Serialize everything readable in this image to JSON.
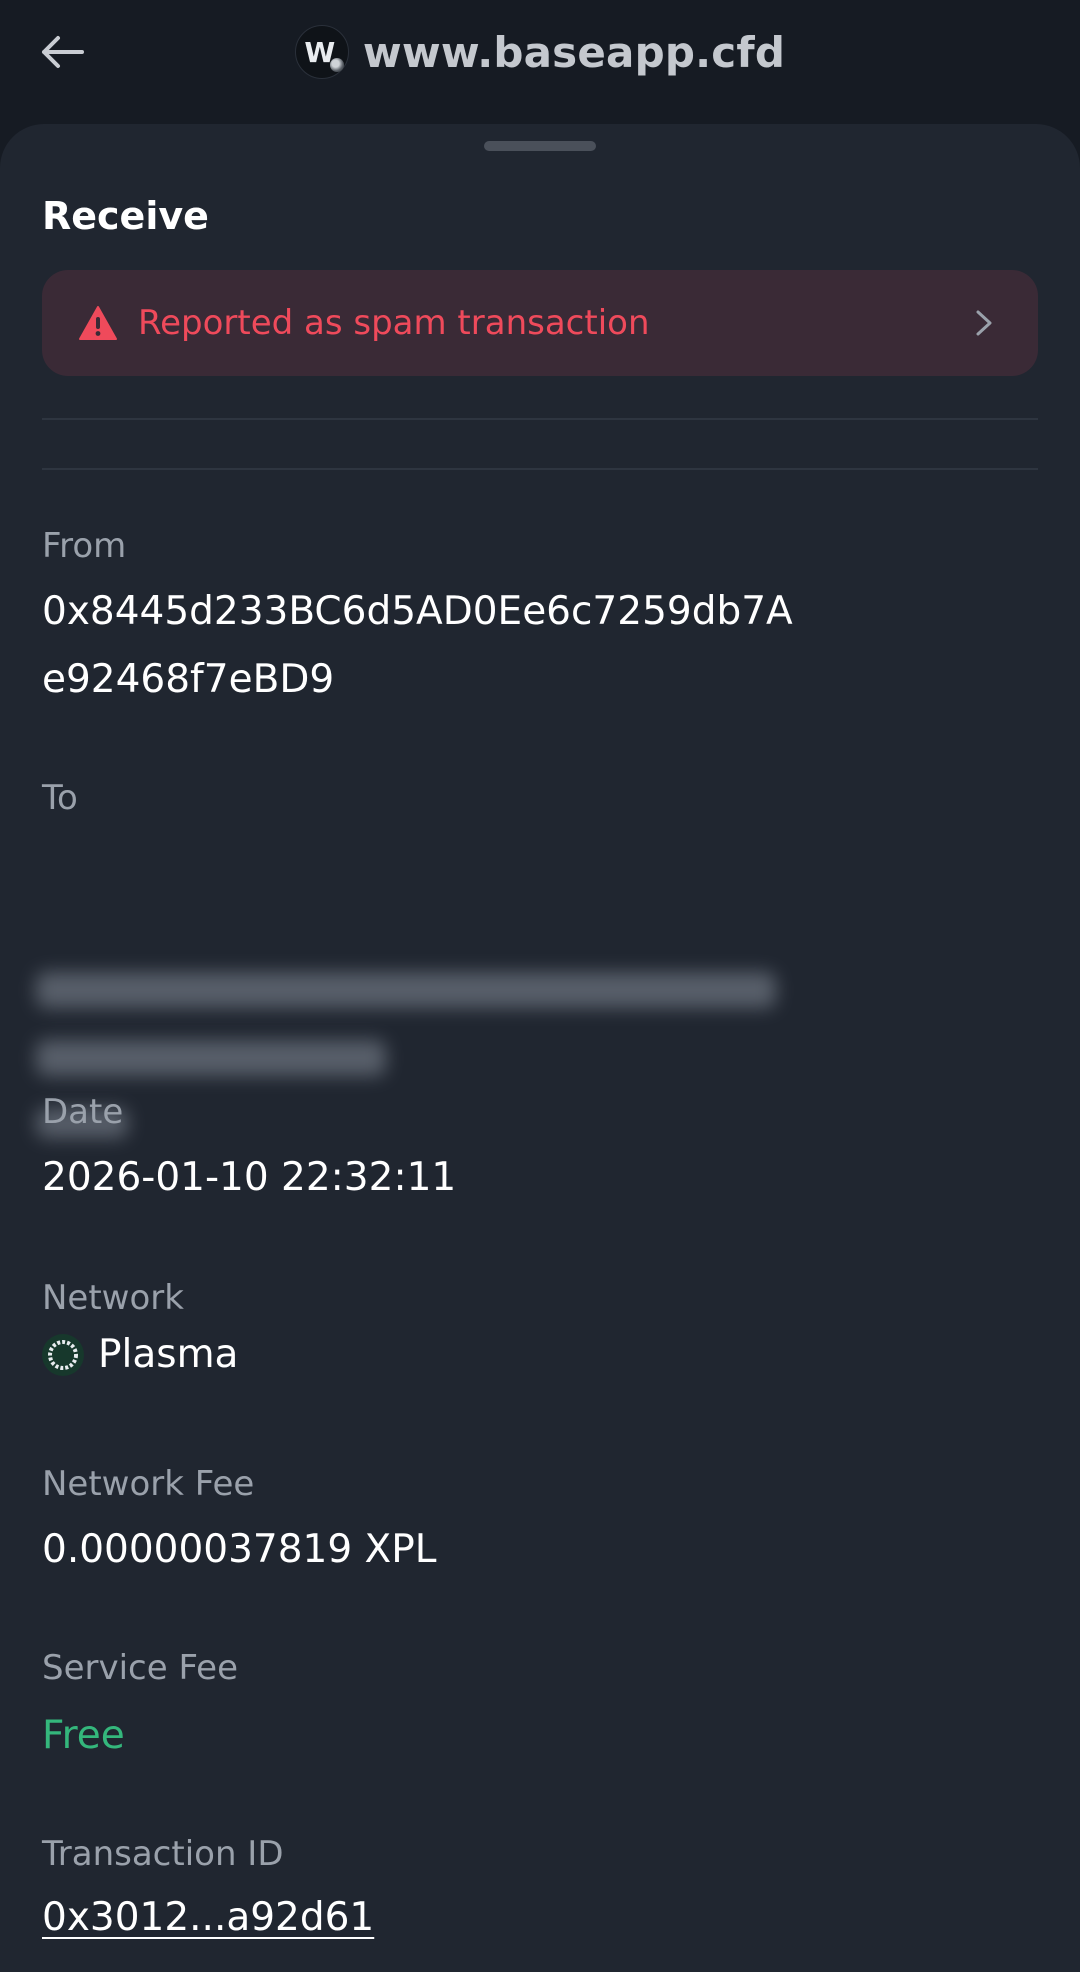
{
  "header": {
    "url": "www.baseapp.cfd",
    "logo_letter": "W",
    "back_icon": "arrow-left-icon"
  },
  "sheet": {
    "title": "Receive",
    "spam_banner": {
      "text": "Reported as spam transaction",
      "icon": "warning-triangle-icon",
      "accent": "#ef4a5b"
    },
    "from": {
      "label": "From",
      "value": "0x8445d233BC6d5AD0Ee6c7259db7Ae92468f7eBD9"
    },
    "to": {
      "label": "To"
    },
    "date": {
      "label": "Date",
      "value": "2026-01-10 22:32:11"
    },
    "network": {
      "label": "Network",
      "value": "Plasma",
      "icon": "plasma-network-icon"
    },
    "network_fee": {
      "label": "Network Fee",
      "value": "0.00000037819 XPL"
    },
    "service_fee": {
      "label": "Service Fee",
      "value": "Free",
      "color": "#34b77c"
    },
    "transaction_id": {
      "label": "Transaction ID",
      "value": "0x3012...a92d61"
    }
  }
}
